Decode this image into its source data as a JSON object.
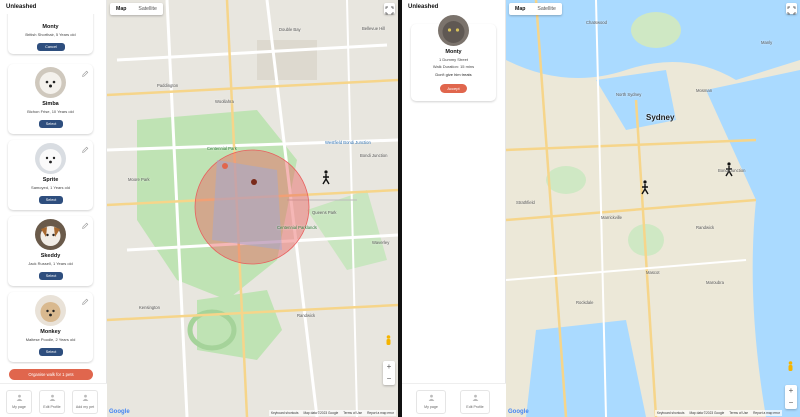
{
  "left": {
    "app_title": "Unleashed",
    "dogs": [
      {
        "name": "Monty",
        "meta": "British Shorthair, 5 Years old",
        "button": "Cancel"
      },
      {
        "name": "Simba",
        "meta": "Bichon Frise, 10 Years old",
        "button": "Select"
      },
      {
        "name": "Sprite",
        "meta": "Samoyed, 1 Years old",
        "button": "Select"
      },
      {
        "name": "Skeddy",
        "meta": "Jack Russell, 1 Years old",
        "button": "Select"
      },
      {
        "name": "Monkey",
        "meta": "Maltese Poodle, 2 Years old",
        "button": "Select"
      }
    ],
    "organise_button": "Organise walk for 1 pets",
    "tabs": [
      "My page",
      "Edit Profile",
      "Add my pet"
    ],
    "map": {
      "toggle": [
        "Map",
        "Satellite"
      ],
      "active_toggle": "Map",
      "zoom_in": "+",
      "zoom_out": "−",
      "google": "Google",
      "footer": [
        "Keyboard shortcuts",
        "Map data ©2023 Google",
        "Terms of Use",
        "Report a map error"
      ],
      "labels": [
        "Paddington",
        "Woollahra",
        "Double Bay",
        "Bellevue Hill",
        "Moore Park",
        "Centennial Park",
        "Queens Park",
        "Bondi Junction",
        "Waverley",
        "Kensington",
        "Randwick",
        "Centennial Parklands",
        "Westfield Bondi Junction"
      ]
    }
  },
  "right": {
    "app_title": "Unleashed",
    "request": {
      "name": "Monty",
      "address": "1 Dummy Street",
      "duration": "Walk Duration: 15 mins",
      "note": "Don't give him treats",
      "button": "Accept"
    },
    "tabs": [
      "My page",
      "Edit Profile"
    ],
    "map": {
      "toggle": [
        "Map",
        "Satellite"
      ],
      "active_toggle": "Map",
      "zoom_in": "+",
      "zoom_out": "−",
      "google": "Google",
      "footer": [
        "Keyboard shortcuts",
        "Map data ©2023 Google",
        "Terms of Use",
        "Report a map error"
      ],
      "labels": [
        "Sydney",
        "Manly",
        "Mosman",
        "North Sydney",
        "Chatswood",
        "Bondi Junction",
        "Randwick",
        "Maroubra",
        "Mascot",
        "Rockdale",
        "Marrickville",
        "Strathfield"
      ]
    }
  },
  "colors": {
    "accent": "#e0664d",
    "primary_button": "#2e4e7e",
    "walk_radius": "#e8605e"
  }
}
